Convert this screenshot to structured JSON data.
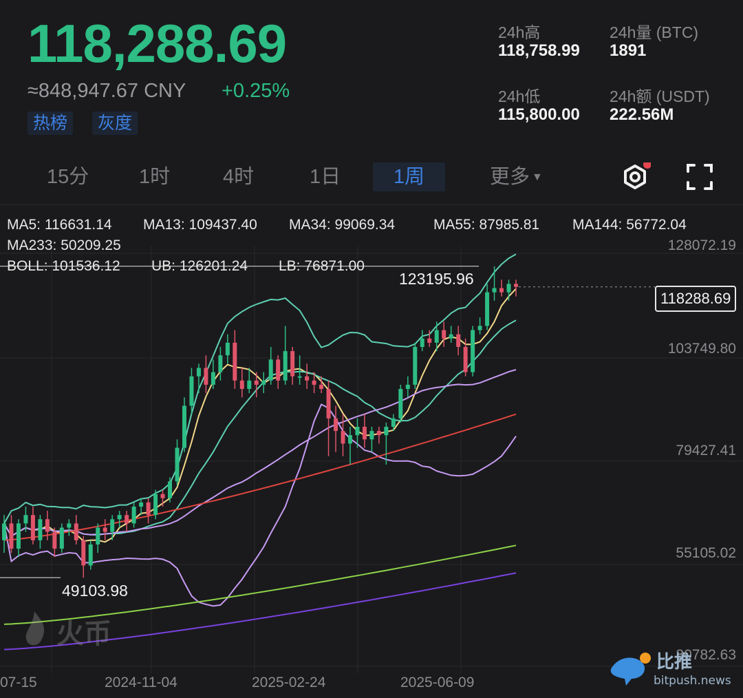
{
  "header": {
    "price": "118,288.69",
    "cny": "≈848,947.67 CNY",
    "change": "+0.25%",
    "tags": [
      "热榜",
      "灰度"
    ],
    "stats": [
      {
        "label": "24h高",
        "value": "118,758.99"
      },
      {
        "label": "24h量 (BTC)",
        "value": "1891"
      },
      {
        "label": "24h低",
        "value": "115,800.00"
      },
      {
        "label": "24h额 (USDT)",
        "value": "222.56M"
      }
    ]
  },
  "tabs": [
    "15分",
    "1时",
    "4时",
    "1日",
    "1周",
    "更多"
  ],
  "active_tab": "1周",
  "legend": {
    "ma5": "MA5: 116631.14",
    "ma13": "MA13: 109437.40",
    "ma34": "MA34: 99069.34",
    "ma55": "MA55: 87985.81",
    "ma144": "MA144: 56772.04",
    "ma233": "MA233: 50209.25",
    "boll": "BOLL: 101536.12",
    "ub": "UB: 126201.24",
    "lb": "LB: 76871.00"
  },
  "colors": {
    "up": "#2dbd85",
    "down": "#e0546a",
    "ma5": "#f4d98a",
    "ma13": "#5fd0b4",
    "ma34": "#c79bf2",
    "ma55": "#e0453f",
    "ma144": "#8fd44a",
    "ma233": "#7a42e0",
    "boll": "#f0d580"
  },
  "chart": {
    "y_ticks": [
      "128072.19",
      "103749.80",
      "79427.41",
      "55105.02",
      "30782.63"
    ],
    "x_ticks": [
      "07-15",
      "2024-11-04",
      "2025-02-24",
      "2025-06-09"
    ],
    "current_price_label": "118288.69",
    "high_label": "123195.96",
    "low_label": "49103.98"
  },
  "chart_data": {
    "type": "candlestick",
    "ylim": [
      30782.63,
      128072.19
    ],
    "current_price": 118288.69,
    "high": 123195.96,
    "low": 49103.98,
    "indicators": {
      "MA5": 116631.14,
      "MA13": 109437.4,
      "MA34": 99069.34,
      "MA55": 87985.81,
      "MA144": 56772.04,
      "MA233": 50209.25,
      "BOLL": 101536.12,
      "UB": 126201.24,
      "LB": 76871.0
    },
    "candles": [
      [
        58000,
        62000,
        55000,
        64000
      ],
      [
        62000,
        56000,
        55000,
        64000
      ],
      [
        56000,
        62000,
        54000,
        63000
      ],
      [
        62000,
        64000,
        60000,
        66000
      ],
      [
        64000,
        58000,
        57000,
        66000
      ],
      [
        58000,
        63000,
        56000,
        64000
      ],
      [
        63000,
        60000,
        58000,
        65000
      ],
      [
        60000,
        56000,
        54000,
        61000
      ],
      [
        56000,
        61000,
        55000,
        62000
      ],
      [
        61000,
        62000,
        59000,
        63000
      ],
      [
        62000,
        58000,
        57000,
        64000
      ],
      [
        58000,
        52000,
        49104,
        59000
      ],
      [
        52000,
        57000,
        51000,
        58000
      ],
      [
        57000,
        61000,
        55000,
        62000
      ],
      [
        61000,
        60000,
        58000,
        63000
      ],
      [
        60000,
        63000,
        58000,
        64000
      ],
      [
        63000,
        64000,
        61000,
        65000
      ],
      [
        64000,
        62000,
        60000,
        65000
      ],
      [
        62000,
        66000,
        61000,
        67000
      ],
      [
        66000,
        67000,
        64000,
        68000
      ],
      [
        67000,
        64000,
        62000,
        68000
      ],
      [
        64000,
        69000,
        63000,
        70000
      ],
      [
        69000,
        68000,
        66000,
        70000
      ],
      [
        68000,
        72000,
        67000,
        73000
      ],
      [
        72000,
        80000,
        71000,
        82000
      ],
      [
        80000,
        90000,
        79000,
        92000
      ],
      [
        90000,
        97000,
        88000,
        99000
      ],
      [
        97000,
        99000,
        93000,
        100000
      ],
      [
        99000,
        95000,
        93000,
        102000
      ],
      [
        95000,
        98000,
        94000,
        101000
      ],
      [
        98000,
        102000,
        96000,
        104000
      ],
      [
        102000,
        105000,
        100000,
        107000
      ],
      [
        105000,
        96000,
        94000,
        108000
      ],
      [
        96000,
        94000,
        92000,
        99000
      ],
      [
        94000,
        96000,
        93000,
        99000
      ],
      [
        96000,
        95000,
        92000,
        98000
      ],
      [
        95000,
        96000,
        93000,
        98000
      ],
      [
        96000,
        101000,
        95000,
        104000
      ],
      [
        101000,
        96000,
        94000,
        102000
      ],
      [
        96000,
        103000,
        95000,
        109000
      ],
      [
        103000,
        97000,
        95000,
        104000
      ],
      [
        97000,
        97000,
        95000,
        102000
      ],
      [
        97000,
        96000,
        94000,
        100000
      ],
      [
        96000,
        95000,
        93000,
        98000
      ],
      [
        95000,
        94000,
        93000,
        97000
      ],
      [
        94000,
        87000,
        78000,
        96000
      ],
      [
        87000,
        84000,
        79000,
        90000
      ],
      [
        84000,
        81000,
        78000,
        88000
      ],
      [
        81000,
        83000,
        76000,
        85000
      ],
      [
        83000,
        85000,
        80000,
        87000
      ],
      [
        85000,
        82000,
        80000,
        88000
      ],
      [
        82000,
        84000,
        79000,
        85000
      ],
      [
        84000,
        83000,
        81000,
        85000
      ],
      [
        83000,
        85000,
        76000,
        86000
      ],
      [
        85000,
        87000,
        84000,
        88000
      ],
      [
        87000,
        94000,
        86000,
        95000
      ],
      [
        94000,
        95000,
        92000,
        97000
      ],
      [
        95000,
        104000,
        94000,
        105000
      ],
      [
        104000,
        106000,
        103000,
        108000
      ],
      [
        106000,
        105000,
        104000,
        108000
      ],
      [
        105000,
        108000,
        103000,
        110000
      ],
      [
        108000,
        106000,
        104000,
        110000
      ],
      [
        106000,
        107000,
        105000,
        109000
      ],
      [
        107000,
        104000,
        102000,
        109000
      ],
      [
        104000,
        98000,
        97000,
        106000
      ],
      [
        98000,
        108000,
        97000,
        109000
      ],
      [
        108000,
        109000,
        107000,
        111000
      ],
      [
        109000,
        117000,
        108000,
        119000
      ],
      [
        117000,
        118000,
        115000,
        123196
      ],
      [
        118000,
        117000,
        116000,
        120000
      ],
      [
        117000,
        119000,
        115000,
        120000
      ],
      [
        119000,
        118289,
        116000,
        120000
      ]
    ]
  }
}
